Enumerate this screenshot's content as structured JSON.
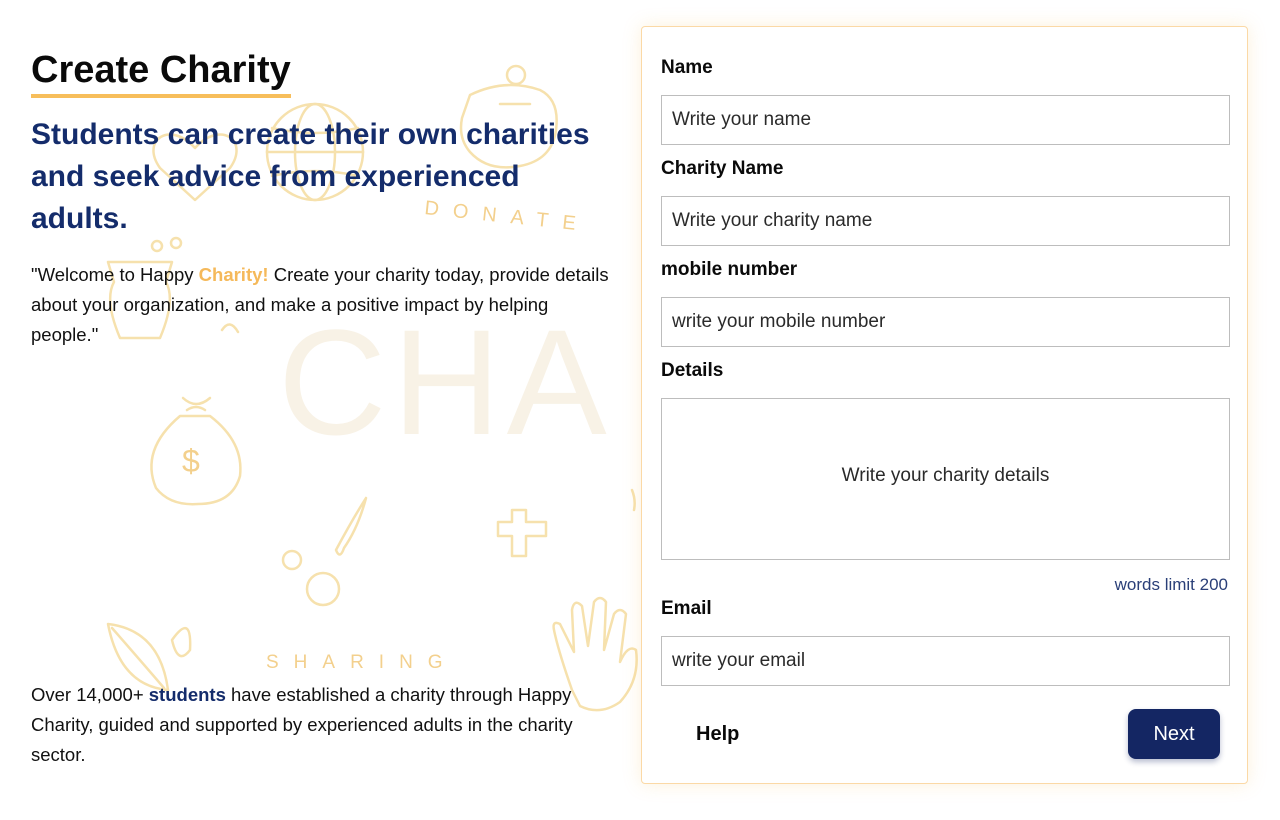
{
  "hero": {
    "title": "Create Charity",
    "subtitle": "Students can create their own charities and seek advice from experienced adults.",
    "welcome_before": "\"Welcome to Happy ",
    "welcome_highlight": "Charity!",
    "welcome_after": " Create your charity today, provide details about your organization, and make a positive impact by helping people.\"",
    "stats_before": "Over 14,000+ ",
    "stats_highlight": "students",
    "stats_after": " have established a charity through Happy Charity, guided and supported by experienced adults in the charity sector."
  },
  "background": {
    "word_donate": "DONATE",
    "word_sharing": "SHARING",
    "word_charity": "CHA",
    "dollar": "$"
  },
  "form": {
    "name_label": "Name",
    "name_placeholder": "Write your name",
    "charity_name_label": "Charity Name",
    "charity_name_placeholder": "Write your charity name",
    "mobile_label": "mobile number",
    "mobile_placeholder": "write your mobile number",
    "details_label": "Details",
    "details_placeholder": "Write your charity details",
    "words_limit": "words limit 200",
    "email_label": "Email",
    "email_placeholder": "write your email",
    "help_label": "Help",
    "next_label": "Next"
  },
  "colors": {
    "accent_yellow": "#f7be5b",
    "brand_navy": "#142c6b",
    "button_navy": "#142663",
    "card_border": "#fbd9a6"
  }
}
